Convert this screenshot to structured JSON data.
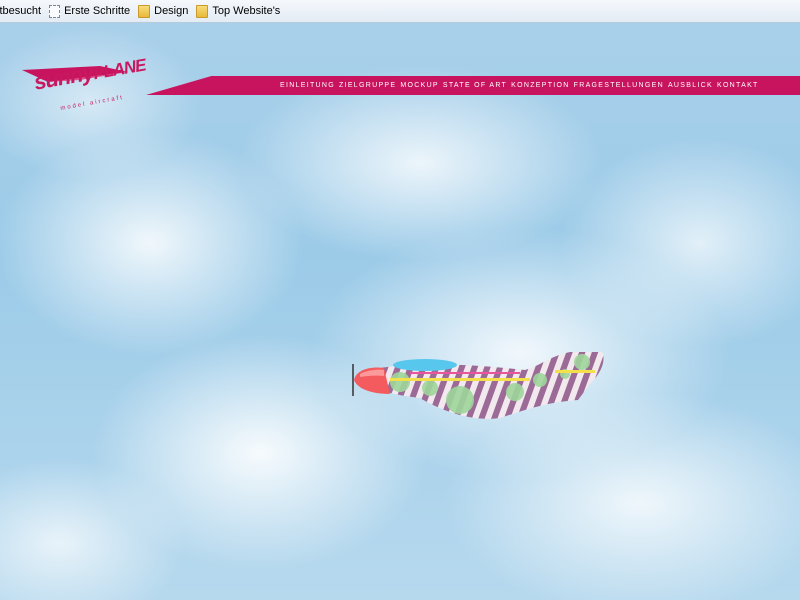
{
  "bookmarks": [
    {
      "label": "stbesucht",
      "icon": "page-icon"
    },
    {
      "label": "Erste Schritte",
      "icon": "page-icon"
    },
    {
      "label": "Design",
      "icon": "folder-icon"
    },
    {
      "label": "Top Website's",
      "icon": "folder-icon"
    }
  ],
  "logo": {
    "main": "sunny",
    "main_caps": "PLANE",
    "sub": "model aircraft"
  },
  "nav": {
    "items": [
      "EINLEITUNG",
      "ZIELGRUPPE",
      "MOCKUP",
      "STATE OF ART",
      "KONZEPTION",
      "FRAGESTELLUNGEN",
      "AUSBLICK",
      "KONTAKT"
    ]
  },
  "colors": {
    "brand": "#c8145e",
    "sky": "#9ccbe8"
  }
}
